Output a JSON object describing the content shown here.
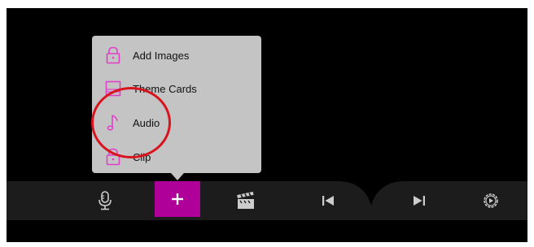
{
  "colors": {
    "background": "#000000",
    "toolbar": "#1c1c1c",
    "accent": "#b0009a",
    "menu": "#c4c4c4",
    "icon_pink": "#e040c8",
    "annotation": "#d8141e"
  },
  "menu": {
    "items": [
      {
        "label": "Add Images",
        "icon": "lock-icon"
      },
      {
        "label": "Theme Cards",
        "icon": "card-stack-icon"
      },
      {
        "label": "Audio",
        "icon": "music-note-icon"
      },
      {
        "label": "Clip",
        "icon": "lock-icon"
      }
    ]
  },
  "toolbar": {
    "buttons": [
      {
        "name": "microphone",
        "icon": "microphone-icon"
      },
      {
        "name": "add",
        "icon": "plus-icon"
      },
      {
        "name": "clapperboard",
        "icon": "clapperboard-icon"
      },
      {
        "name": "previous",
        "icon": "skip-back-icon"
      },
      {
        "name": "next",
        "icon": "skip-forward-icon"
      },
      {
        "name": "settings",
        "icon": "gear-icon"
      }
    ]
  }
}
